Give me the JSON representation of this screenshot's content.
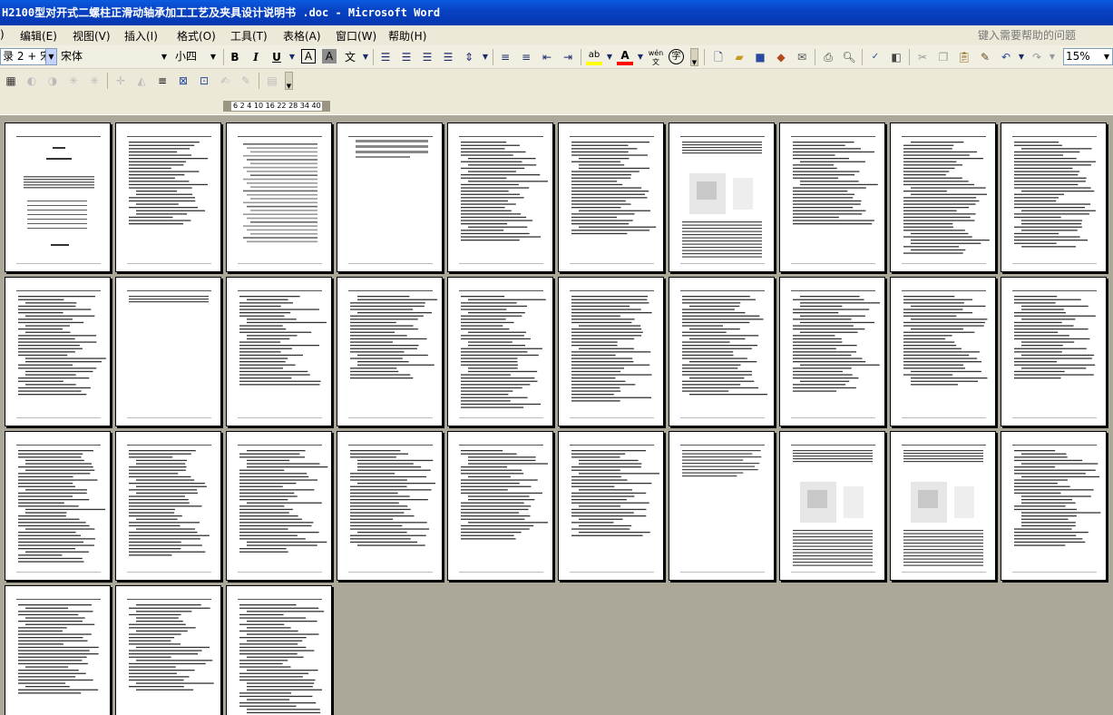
{
  "window": {
    "title": "H2100型对开式二螺柱正滑动轴承加工工艺及夹具设计说明书 .doc - Microsoft Word"
  },
  "menu": {
    "items": [
      ")",
      "编辑(E)",
      "视图(V)",
      "插入(I)",
      "格式(O)",
      "工具(T)",
      "表格(A)",
      "窗口(W)",
      "帮助(H)"
    ],
    "help_placeholder": "键入需要帮助的问题"
  },
  "formatting": {
    "style": "录 2 + 宋",
    "font": "宋体",
    "size": "小四",
    "bold_label": "B",
    "italic_label": "I",
    "underline_label": "U",
    "char_border_label": "A",
    "char_shade_label": "A",
    "font_color_label": "A",
    "phonetic_label": "wén",
    "enclose_label": "字",
    "zoom": "15%"
  },
  "icons": {
    "align_left": "align-left-icon",
    "align_center": "align-center-icon",
    "align_right": "align-right-icon",
    "justify": "justify-icon",
    "line_spacing": "line-spacing-icon",
    "numbering": "numbering-icon",
    "bullets": "bullets-icon",
    "decrease_indent": "decrease-indent-icon",
    "increase_indent": "increase-indent-icon",
    "highlight": "highlight-icon",
    "new": "new-document-icon",
    "open": "open-folder-icon",
    "save": "save-icon",
    "permission": "permission-icon",
    "email": "email-icon",
    "print": "print-icon",
    "print_preview": "print-preview-icon",
    "spelling": "spelling-icon",
    "research": "research-icon",
    "cut": "cut-icon",
    "copy": "copy-icon",
    "paste": "paste-icon",
    "format_painter": "format-painter-icon",
    "undo": "undo-icon",
    "redo": "redo-icon"
  },
  "ruler": {
    "ticks": "6  2  4  10 16 22 28 34 40"
  },
  "colors": {
    "titlebar": "#0a5be0",
    "workspace": "#aca899",
    "toolbar": "#f1efe2",
    "highlight_yellow": "#ffff00",
    "font_red": "#ff0000"
  },
  "document": {
    "page_count": 33,
    "pages_per_row": 10
  }
}
